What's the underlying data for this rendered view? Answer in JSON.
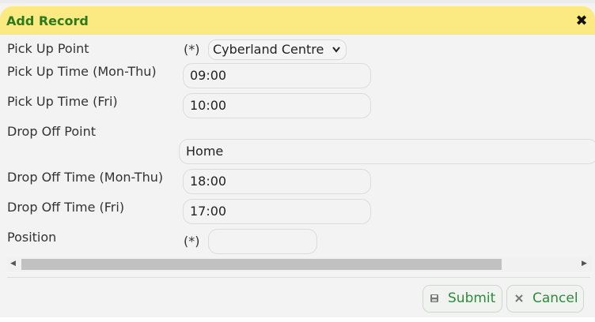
{
  "dialog": {
    "title": "Add Record",
    "close_icon": "close-icon",
    "close_glyph": "✖"
  },
  "form": {
    "pickup_point": {
      "label": "Pick Up Point",
      "required": "(*)",
      "value": "Cyberland Centre"
    },
    "pickup_time_mon_thu": {
      "label": "Pick Up Time (Mon-Thu)",
      "value": "09:00"
    },
    "pickup_time_fri": {
      "label": "Pick Up Time (Fri)",
      "value": "10:00"
    },
    "dropoff_point": {
      "label": "Drop Off Point",
      "value": "Home"
    },
    "dropoff_time_mon_thu": {
      "label": "Drop Off Time (Mon-Thu)",
      "value": "18:00"
    },
    "dropoff_time_fri": {
      "label": "Drop Off Time (Fri)",
      "value": "17:00"
    },
    "position": {
      "label": "Position",
      "required": "(*)",
      "value": ""
    }
  },
  "scrollbar": {
    "left_icon": "scroll-left-icon",
    "right_icon": "scroll-right-icon"
  },
  "buttons": {
    "submit": {
      "label": "Submit",
      "icon": "save-icon"
    },
    "cancel": {
      "label": "Cancel",
      "icon": "x-icon"
    }
  },
  "colors": {
    "titlebar_bg": "#fbe982",
    "title_text": "#2b7a1c",
    "button_text": "#2e8b3a"
  }
}
